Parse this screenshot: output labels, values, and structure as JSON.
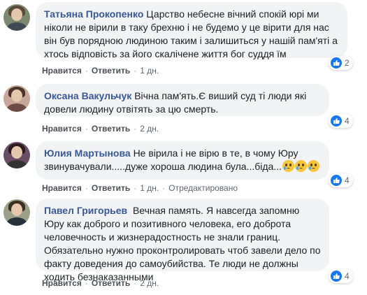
{
  "comments": [
    {
      "author": "Татьяна Прокопенко",
      "text": "Царство небесне вічний спокій юрі ми ніколи не вірили в таку брехню і не будемо у це вірити для нас він був порядною людиною таким і залишиться у нашій пам'яті а хтось відповість за його скалічене життя бог суддя їм",
      "like": "Нравится",
      "reply": "Ответить",
      "time": "1 дн.",
      "reactions": "2"
    },
    {
      "author": "Оксана Вакульчук",
      "text": "Вічна пам'ять.Є виший суд ті люди які довели людину отвітять за цю смерть.",
      "like": "Нравится",
      "reply": "Ответить",
      "time": "2 дн.",
      "reactions": "4"
    },
    {
      "author": "Юлия Мартынова",
      "text": "Не вірила і не вірю в те, в чому Юру звинувачували.....дуже хороша людина була...біда...",
      "like": "Нравится",
      "reply": "Ответить",
      "time": "1 дн.",
      "edited": "Отредактировано",
      "reactions": "4"
    },
    {
      "author": "Павел Григорьев",
      "text": "Вечная память. Я навсегда запомню Юру как доброго и позитивного человека, его доброта человечность и жизнерадостность не знали границ. Обязательно нужно проконтролировать чтоб завели дело по факту доведения до самоубийства. Те люди не должны ходить безнаказанными",
      "like": "Нравится",
      "reply": "Ответить",
      "time": "2 дн.",
      "reactions": "4"
    }
  ],
  "colors": {
    "author": "#385898",
    "bubble": "#f2f3f5",
    "like_badge": "#1877f2"
  },
  "icons": {
    "reaction": "like-icon",
    "emoji": "crying-face-icon"
  }
}
